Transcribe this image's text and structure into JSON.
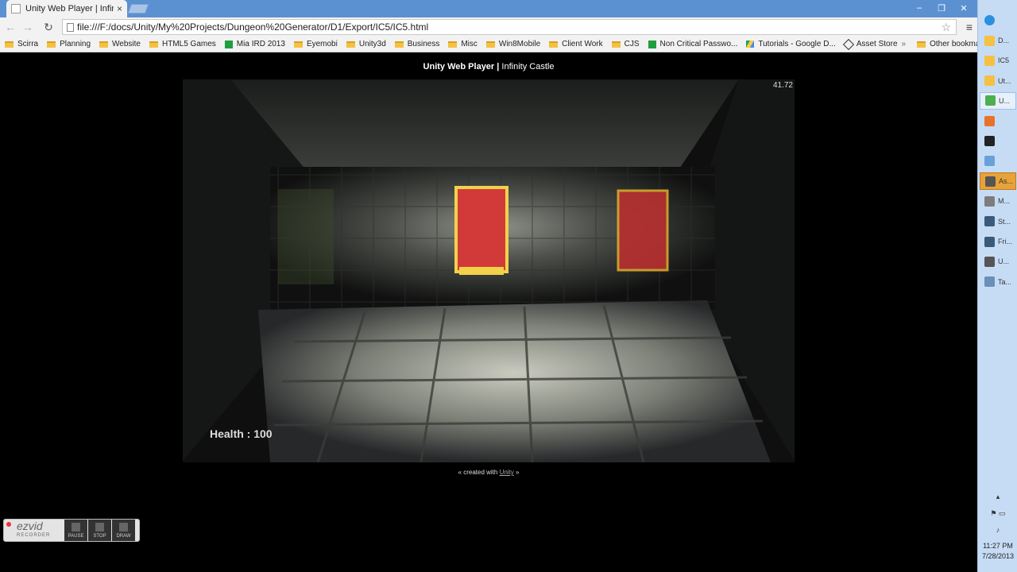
{
  "browser": {
    "tab_title": "Unity Web Player | Infinity",
    "tab_close": "×",
    "url": "file:///F:/docs/Unity/My%20Projects/Dungeon%20Generator/D1/Export/IC5/IC5.html",
    "back": "←",
    "forward": "→",
    "reload": "↻",
    "star": "☆",
    "menu": "≡",
    "window_minimize": "–",
    "window_restore": "❐",
    "window_close": "✕"
  },
  "bookmarks": [
    {
      "label": "Scirra",
      "icon": "folder-icon"
    },
    {
      "label": "Planning",
      "icon": "folder-icon"
    },
    {
      "label": "Website",
      "icon": "folder-icon"
    },
    {
      "label": "HTML5 Games",
      "icon": "folder-icon"
    },
    {
      "label": "Mia IRD 2013",
      "icon": "sheet-icon"
    },
    {
      "label": "Eyemobi",
      "icon": "folder-icon"
    },
    {
      "label": "Unity3d",
      "icon": "folder-icon"
    },
    {
      "label": "Business",
      "icon": "folder-icon"
    },
    {
      "label": "Misc",
      "icon": "folder-icon"
    },
    {
      "label": "Win8Mobile",
      "icon": "folder-icon"
    },
    {
      "label": "Client Work",
      "icon": "folder-icon"
    },
    {
      "label": "CJS",
      "icon": "folder-icon"
    },
    {
      "label": "Non Critical Passwo...",
      "icon": "sheet-icon"
    },
    {
      "label": "Tutorials - Google D...",
      "icon": "drive-icon"
    },
    {
      "label": "Asset Store",
      "icon": "unity-icon"
    }
  ],
  "bookmarks_overflow": "»",
  "other_bookmarks": "Other bookmarks",
  "page": {
    "title_main": "Unity Web Player",
    "title_sep": " | ",
    "title_sub": "Infinity Castle",
    "credit_prefix": "« created with ",
    "credit_link": "Unity",
    "credit_suffix": " »"
  },
  "game": {
    "fps": "41.72",
    "health": "Health : 100"
  },
  "ezvid": {
    "logo": "ezvid",
    "logo_sub": "RECORDER",
    "pause": "PAUSE",
    "stop": "STOP",
    "draw": "DRAW"
  },
  "taskbar": {
    "items": [
      {
        "label": "D...",
        "icon": "folder-icon"
      },
      {
        "label": "IC5",
        "icon": "folder-icon"
      },
      {
        "label": "Ut...",
        "icon": "folder-icon"
      },
      {
        "label": "U...",
        "icon": "chrome-icon"
      },
      {
        "label": "",
        "icon": "firefox-icon"
      },
      {
        "label": "",
        "icon": "terminal-icon"
      },
      {
        "label": "",
        "icon": "window-icon"
      },
      {
        "label": "As...",
        "icon": "unity-icon"
      },
      {
        "label": "M...",
        "icon": "monodevelop-icon"
      },
      {
        "label": "St...",
        "icon": "steam-icon"
      },
      {
        "label": "Fri...",
        "icon": "steam-icon"
      },
      {
        "label": "U...",
        "icon": "unity-icon"
      },
      {
        "label": "Ta...",
        "icon": "image-icon"
      }
    ],
    "time": "11:27 PM",
    "date": "7/28/2013"
  }
}
